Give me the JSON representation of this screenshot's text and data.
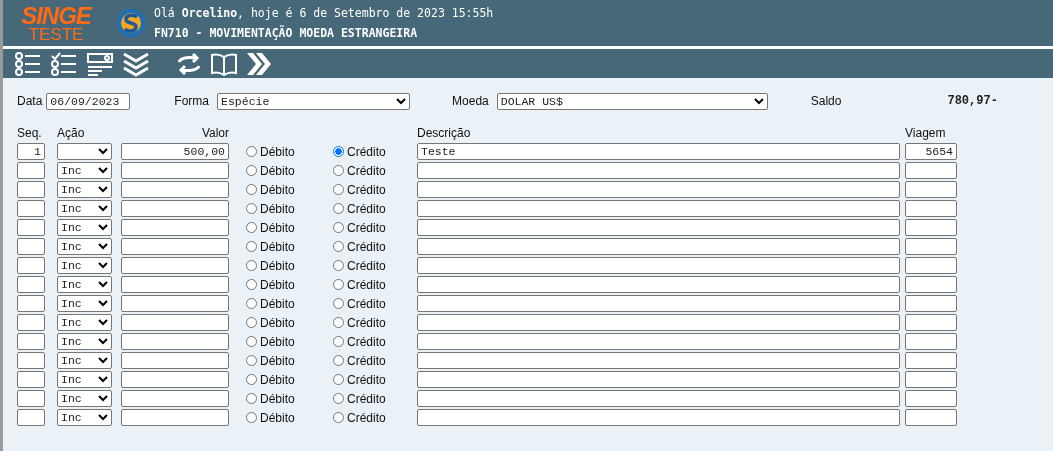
{
  "logo": {
    "brand": "SINGE",
    "environment": "TESTE"
  },
  "header": {
    "greeting": "Olá **Orcelino**, hoje é 6 de Setembro de 2023 15:55h",
    "screen_title": "FN710 - MOVIMENTAÇÃO MOEDA ESTRANGEIRA"
  },
  "filters": {
    "data_label": "Data",
    "data_value": "06/09/2023",
    "forma_label": "Forma",
    "forma_value": "Espécie",
    "moeda_label": "Moeda",
    "moeda_value": "DOLAR US$",
    "saldo_label": "Saldo",
    "saldo_value": "780,97-"
  },
  "columns": {
    "seq": "Seq.",
    "acao": "Ação",
    "valor": "Valor",
    "descricao": "Descrição",
    "viagem": "Viagem"
  },
  "rows": [
    {
      "seq": "1",
      "acao": "",
      "valor": "500,00",
      "debit": {
        "label": "Débito",
        "selected": false
      },
      "credit": {
        "label": "Crédito",
        "selected": true
      },
      "descricao": "Teste",
      "viagem": "5654"
    },
    {
      "acao": "Inc",
      "debit": {
        "label": "Débito",
        "selected": false
      },
      "credit": {
        "label": "Crédito",
        "selected": false
      }
    },
    {
      "acao": "Inc",
      "debit": {
        "label": "Débito",
        "selected": false
      },
      "credit": {
        "label": "Crédito",
        "selected": false
      }
    },
    {
      "acao": "Inc",
      "debit": {
        "label": "Débito",
        "selected": false
      },
      "credit": {
        "label": "Crédito",
        "selected": false
      }
    },
    {
      "acao": "Inc",
      "debit": {
        "label": "Débito",
        "selected": false
      },
      "credit": {
        "label": "Crédito",
        "selected": false
      }
    },
    {
      "acao": "Inc",
      "debit": {
        "label": "Débito",
        "selected": false
      },
      "credit": {
        "label": "Crédito",
        "selected": false
      }
    },
    {
      "acao": "Inc",
      "debit": {
        "label": "Débito",
        "selected": false
      },
      "credit": {
        "label": "Crédito",
        "selected": false
      }
    },
    {
      "acao": "Inc",
      "debit": {
        "label": "Débito",
        "selected": false
      },
      "credit": {
        "label": "Crédito",
        "selected": false
      }
    },
    {
      "acao": "Inc",
      "debit": {
        "label": "Débito",
        "selected": false
      },
      "credit": {
        "label": "Crédito",
        "selected": false
      }
    },
    {
      "acao": "Inc",
      "debit": {
        "label": "Débito",
        "selected": false
      },
      "credit": {
        "label": "Crédito",
        "selected": false
      }
    },
    {
      "acao": "Inc",
      "debit": {
        "label": "Débito",
        "selected": false
      },
      "credit": {
        "label": "Crédito",
        "selected": false
      }
    },
    {
      "acao": "Inc",
      "debit": {
        "label": "Débito",
        "selected": false
      },
      "credit": {
        "label": "Crédito",
        "selected": false
      }
    },
    {
      "acao": "Inc",
      "debit": {
        "label": "Débito",
        "selected": false
      },
      "credit": {
        "label": "Crédito",
        "selected": false
      }
    },
    {
      "acao": "Inc",
      "debit": {
        "label": "Débito",
        "selected": false
      },
      "credit": {
        "label": "Crédito",
        "selected": false
      }
    },
    {
      "acao": "Inc",
      "debit": {
        "label": "Débito",
        "selected": false
      },
      "credit": {
        "label": "Crédito",
        "selected": false
      }
    }
  ]
}
